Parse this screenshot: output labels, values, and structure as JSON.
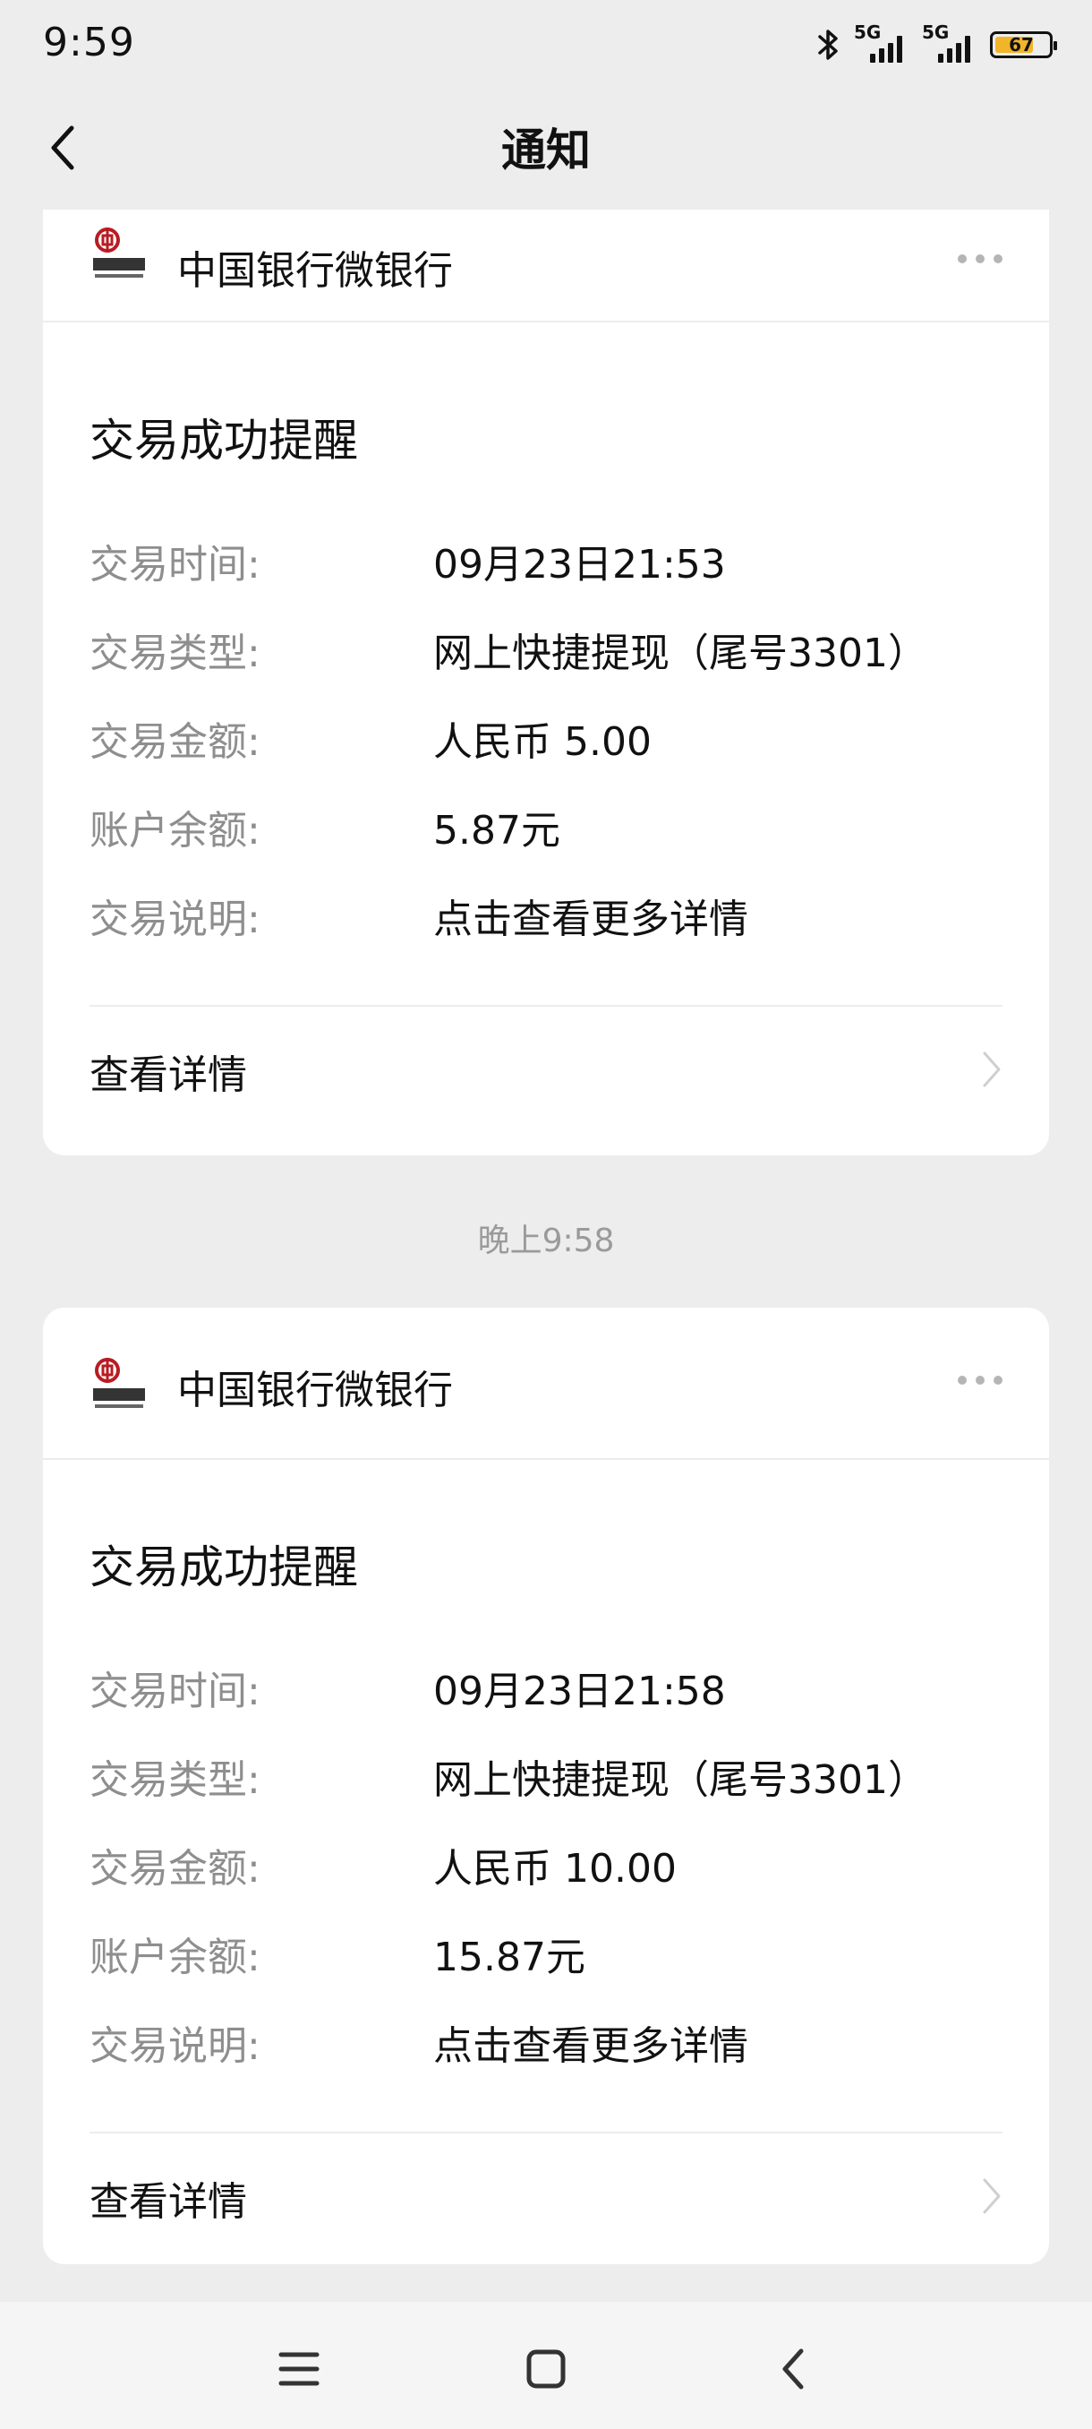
{
  "status_bar": {
    "time": "9:59",
    "network_1": "5G",
    "network_2": "5G",
    "battery": "67",
    "icons": [
      "bluetooth-icon",
      "signal-icon",
      "battery-icon"
    ]
  },
  "nav": {
    "title": "通知",
    "back_icon": "back-chevron-icon"
  },
  "cards": [
    {
      "sender": "中国银行微银行",
      "title": "交易成功提醒",
      "rows": [
        {
          "key": "交易时间:",
          "value": "09月23日21:53"
        },
        {
          "key": "交易类型:",
          "value": "网上快捷提现（尾号3301）"
        },
        {
          "key": "交易金额:",
          "value": "人民币 5.00"
        },
        {
          "key": "账户余额:",
          "value": "5.87元"
        },
        {
          "key": "交易说明:",
          "value": "点击查看更多详情"
        }
      ],
      "detail_label": "查看详情"
    },
    {
      "sender": "中国银行微银行",
      "title": "交易成功提醒",
      "rows": [
        {
          "key": "交易时间:",
          "value": "09月23日21:58"
        },
        {
          "key": "交易类型:",
          "value": "网上快捷提现（尾号3301）"
        },
        {
          "key": "交易金额:",
          "value": "人民币 10.00"
        },
        {
          "key": "账户余额:",
          "value": "15.87元"
        },
        {
          "key": "交易说明:",
          "value": "点击查看更多详情"
        }
      ],
      "detail_label": "查看详情"
    }
  ],
  "timestamps": [
    "晚上9:58"
  ],
  "colors": {
    "background": "#ededed",
    "card": "#ffffff",
    "key_text": "#8e8e8e",
    "bank_red": "#b81c22",
    "battery_fill": "#f2b52a"
  },
  "system_nav": [
    "menu-icon",
    "home-icon",
    "back-icon"
  ]
}
